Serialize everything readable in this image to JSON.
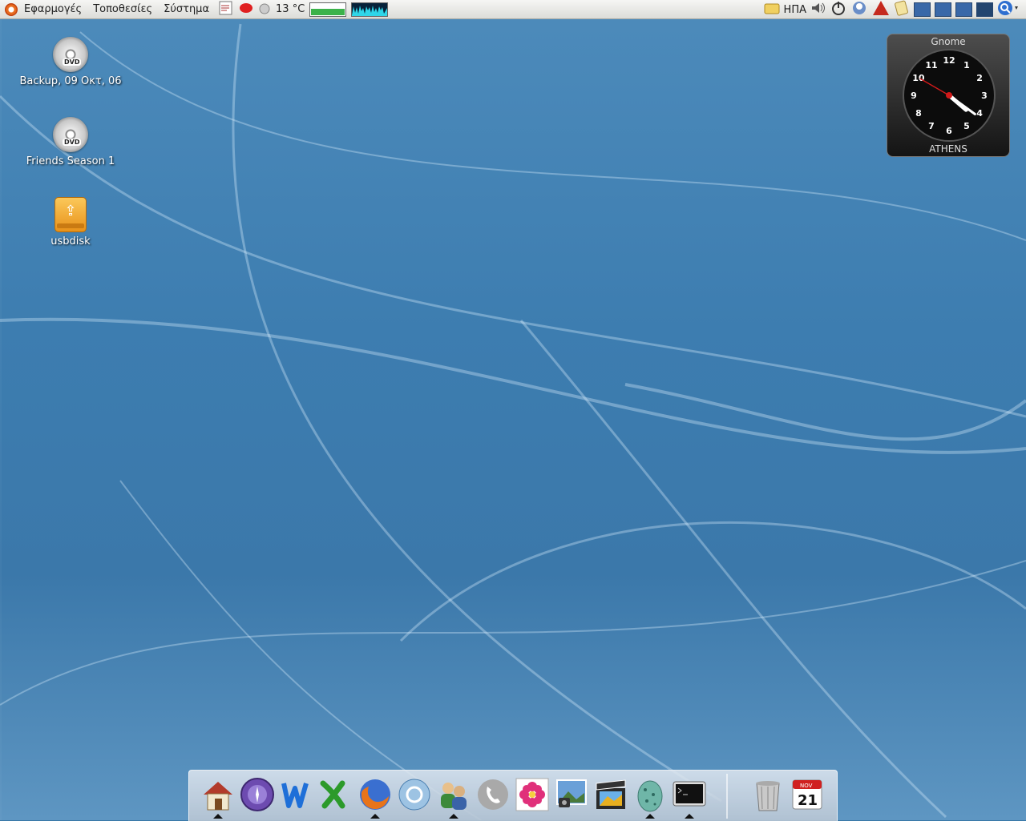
{
  "top_panel": {
    "menus": [
      "Εφαρμογές",
      "Τοποθεσίες",
      "Σύστημα"
    ],
    "temperature": "13 °C",
    "memory_level": 0.55,
    "keyboard_layout": "ΗΠΑ",
    "tray_icons": [
      "notes-icon",
      "record-icon",
      "weather-icon",
      "memory-monitor",
      "cpu-monitor"
    ],
    "right_icons": [
      "folder-icon",
      "volume-icon",
      "power-icon",
      "messenger-icon",
      "rhythmbox-icon",
      "tomboy-icon"
    ],
    "workspaces": 4,
    "active_workspace": 4
  },
  "desktop": {
    "icons": [
      {
        "label": "Backup, 09 Οκτ, 06",
        "type": "dvd-icon",
        "badge": "DVD"
      },
      {
        "label": "Friends Season 1",
        "type": "dvd-icon",
        "badge": "DVD"
      },
      {
        "label": "usbdisk",
        "type": "usb-drive-icon",
        "badge": "⇪"
      }
    ]
  },
  "clock_widget": {
    "caption": "Gnome",
    "city": "ATHENS",
    "numbers": [
      "12",
      "1",
      "2",
      "3",
      "4",
      "5",
      "6",
      "7",
      "8",
      "9",
      "10",
      "11"
    ],
    "time": {
      "hour": 4,
      "minute": 21,
      "second": 50
    }
  },
  "dock": {
    "items": [
      {
        "name": "home-folder-icon",
        "running": true
      },
      {
        "name": "screenshot-app-icon",
        "running": false
      },
      {
        "name": "word-processor-icon",
        "running": false
      },
      {
        "name": "spreadsheet-icon",
        "running": false
      },
      {
        "name": "firefox-icon",
        "running": true
      },
      {
        "name": "email-client-icon",
        "running": false
      },
      {
        "name": "messenger-icon",
        "running": true
      },
      {
        "name": "voip-phone-icon",
        "running": false
      },
      {
        "name": "photo-flower-icon",
        "running": false
      },
      {
        "name": "image-viewer-icon",
        "running": false
      },
      {
        "name": "video-editor-icon",
        "running": false
      },
      {
        "name": "egg-app-icon",
        "running": true
      },
      {
        "name": "terminal-icon",
        "running": true
      },
      {
        "name": "trash-icon",
        "running": false
      },
      {
        "name": "calendar-icon",
        "running": false
      }
    ],
    "calendar": {
      "month": "NOV",
      "day": "21"
    }
  },
  "colors": {
    "desktop_blue": "#3b78aa",
    "panel": "#e8e8e5",
    "ubuntu_orange": "#e86b1f"
  }
}
